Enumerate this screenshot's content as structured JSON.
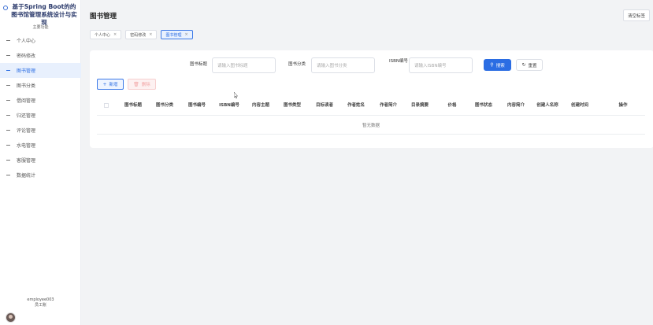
{
  "sidebar": {
    "title": "基于Spring Boot的的图书馆管理系统设计与实现",
    "caption": "主要功能",
    "items": [
      {
        "label": "个人中心"
      },
      {
        "label": "密码修改"
      },
      {
        "label": "图书管理",
        "active": true
      },
      {
        "label": "图书分类"
      },
      {
        "label": "借阅管理"
      },
      {
        "label": "归还管理"
      },
      {
        "label": "评论管理"
      },
      {
        "label": "水电管理"
      },
      {
        "label": "客服管理"
      },
      {
        "label": "数据统计"
      }
    ],
    "user": {
      "name": "employee003",
      "role": "员工账"
    }
  },
  "header": {
    "title": "图书管理",
    "clear_tags_label": "清空标签"
  },
  "tabs": [
    {
      "label": "个人中心",
      "close": "×"
    },
    {
      "label": "密码修改",
      "close": "×"
    },
    {
      "label": "图书管理",
      "close": "×",
      "active": true
    }
  ],
  "search": {
    "title_label": "图书标题",
    "title_placeholder": "请输入图书标题",
    "category_label": "图书分类",
    "category_placeholder": "请输入图书分类",
    "isbn_label": "ISBN编号",
    "isbn_placeholder": "请输入ISBN编号",
    "search_button": "搜索",
    "reset_button": "重置"
  },
  "toolbar": {
    "add_label": "新增",
    "delete_label": "删除"
  },
  "table": {
    "columns": [
      "图书标题",
      "图书分类",
      "图书编号",
      "ISBN编号",
      "内容主题",
      "图书类型",
      "目标读者",
      "作者姓名",
      "作者简介",
      "目录摘要",
      "价格",
      "图书状态",
      "内容简介",
      "创建人名称",
      "创建时间",
      "操作"
    ],
    "empty_text": "暂无数据"
  }
}
